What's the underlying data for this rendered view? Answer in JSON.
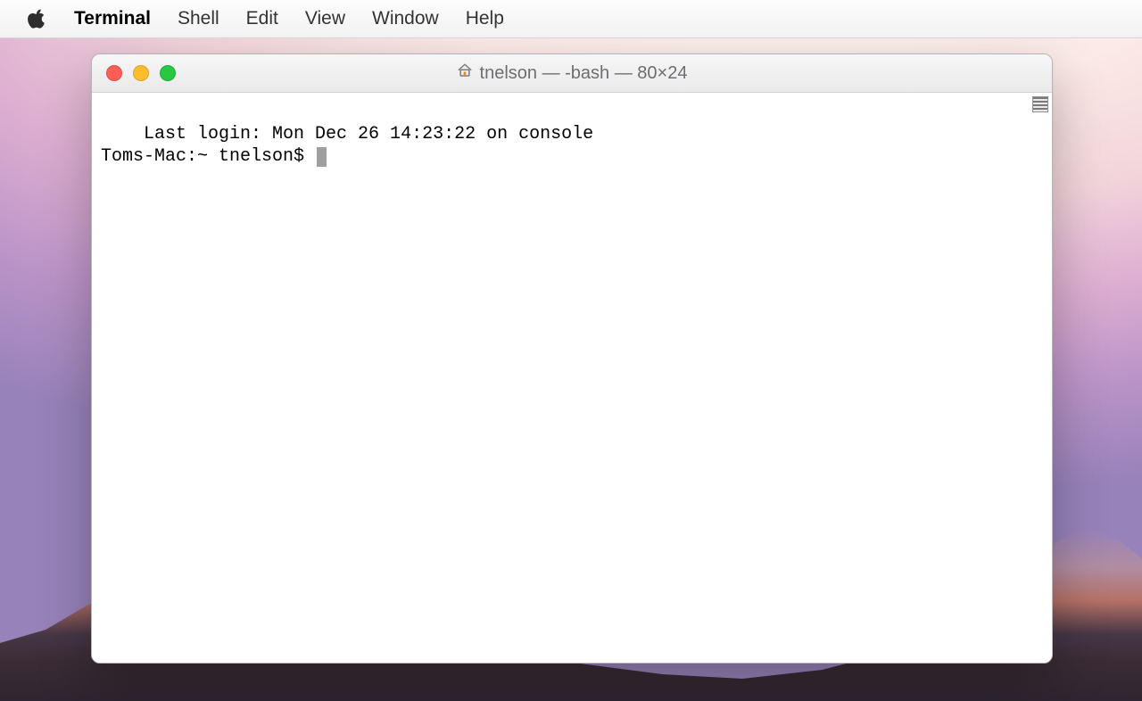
{
  "menubar": {
    "app_name": "Terminal",
    "items": [
      "Shell",
      "Edit",
      "View",
      "Window",
      "Help"
    ]
  },
  "window": {
    "title": "tnelson — -bash — 80×24"
  },
  "terminal": {
    "last_login_line": "Last login: Mon Dec 26 14:23:22 on console",
    "prompt": "Toms-Mac:~ tnelson$ "
  }
}
